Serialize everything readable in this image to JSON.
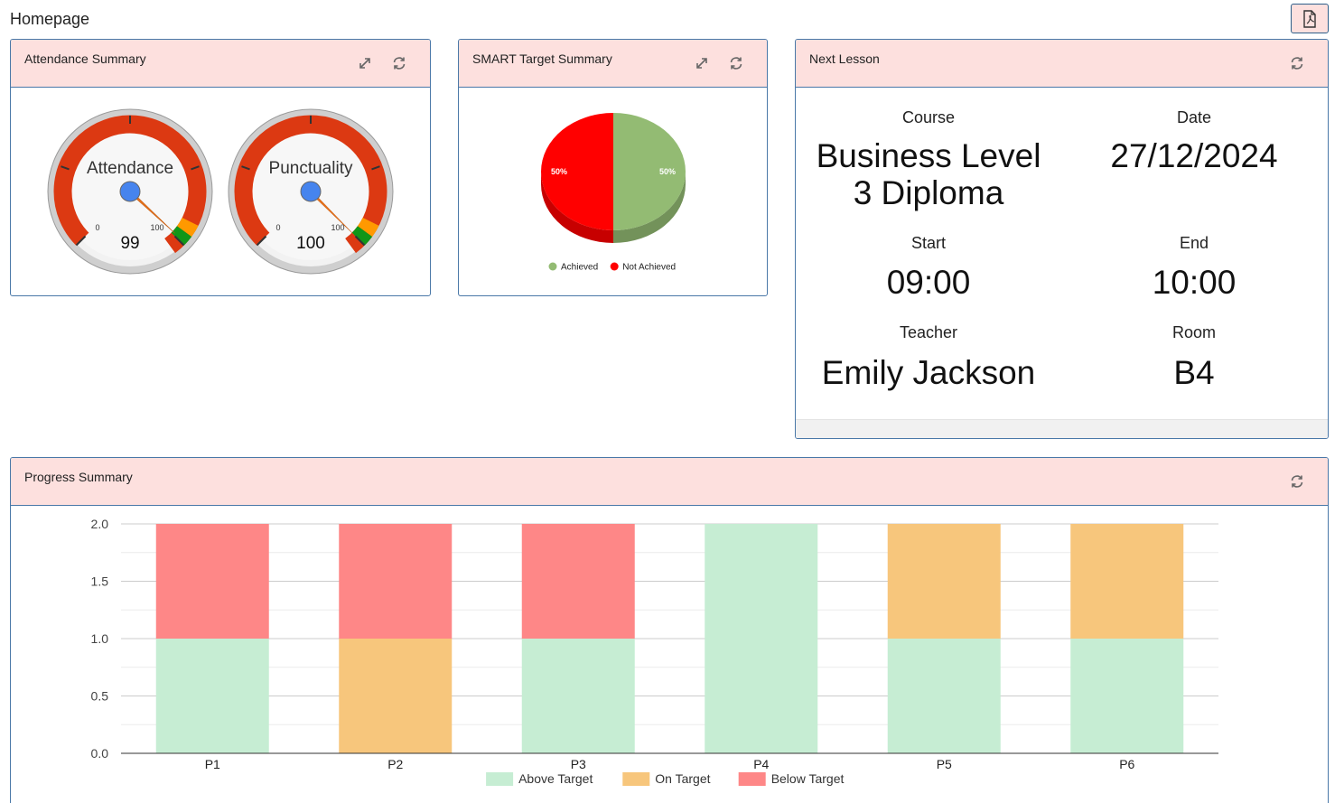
{
  "page": {
    "title": "Homepage",
    "pdf_icon": "pdf-file-icon"
  },
  "attendance": {
    "title": "Attendance Summary",
    "icons": [
      "expand-icon",
      "refresh-icon"
    ],
    "gauges": [
      {
        "label": "Attendance",
        "value": "99",
        "min": "0",
        "max": "100"
      },
      {
        "label": "Punctuality",
        "value": "100",
        "min": "0",
        "max": "100"
      }
    ],
    "colors": {
      "red": "#dc3912",
      "orange": "#ff9900",
      "green": "#109618",
      "needle": "#e7711b",
      "hub": "#4684ee"
    }
  },
  "smart": {
    "title": "SMART Target Summary",
    "icons": [
      "expand-icon",
      "refresh-icon"
    ],
    "chart_data": {
      "type": "pie",
      "slices": [
        {
          "name": "Achieved",
          "value": 50,
          "label": "50%",
          "color": "#93bb73"
        },
        {
          "name": "Not Achieved",
          "value": 50,
          "label": "50%",
          "color": "#ff0000"
        }
      ],
      "legend_position": "bottom"
    }
  },
  "next_lesson": {
    "title": "Next Lesson",
    "icons": [
      "refresh-icon"
    ],
    "course_label": "Course",
    "course_line1": "Business Level",
    "course_line2": "3 Diploma",
    "date_label": "Date",
    "date": "27/12/2024",
    "start_label": "Start",
    "start": "09:00",
    "end_label": "End",
    "end": "10:00",
    "teacher_label": "Teacher",
    "teacher": "Emily Jackson",
    "room_label": "Room",
    "room": "B4"
  },
  "progress": {
    "title": "Progress Summary",
    "icons": [
      "refresh-icon"
    ],
    "chart_data": {
      "type": "bar",
      "stacked": true,
      "categories": [
        "P1",
        "P2",
        "P3",
        "P4",
        "P5",
        "P6"
      ],
      "series": [
        {
          "name": "Above Target",
          "color": "#c6edd3",
          "values": [
            1,
            0,
            1,
            2,
            1,
            1
          ]
        },
        {
          "name": "On Target",
          "color": "#f7c67c",
          "values": [
            0,
            1,
            0,
            0,
            1,
            1
          ]
        },
        {
          "name": "Below Target",
          "color": "#fe8787",
          "values": [
            1,
            1,
            1,
            0,
            0,
            0
          ]
        }
      ],
      "yticks": [
        "0.0",
        "0.5",
        "1.0",
        "1.5",
        "2.0"
      ],
      "ylim": [
        0,
        2
      ],
      "grid": true,
      "legend_position": "bottom"
    }
  }
}
